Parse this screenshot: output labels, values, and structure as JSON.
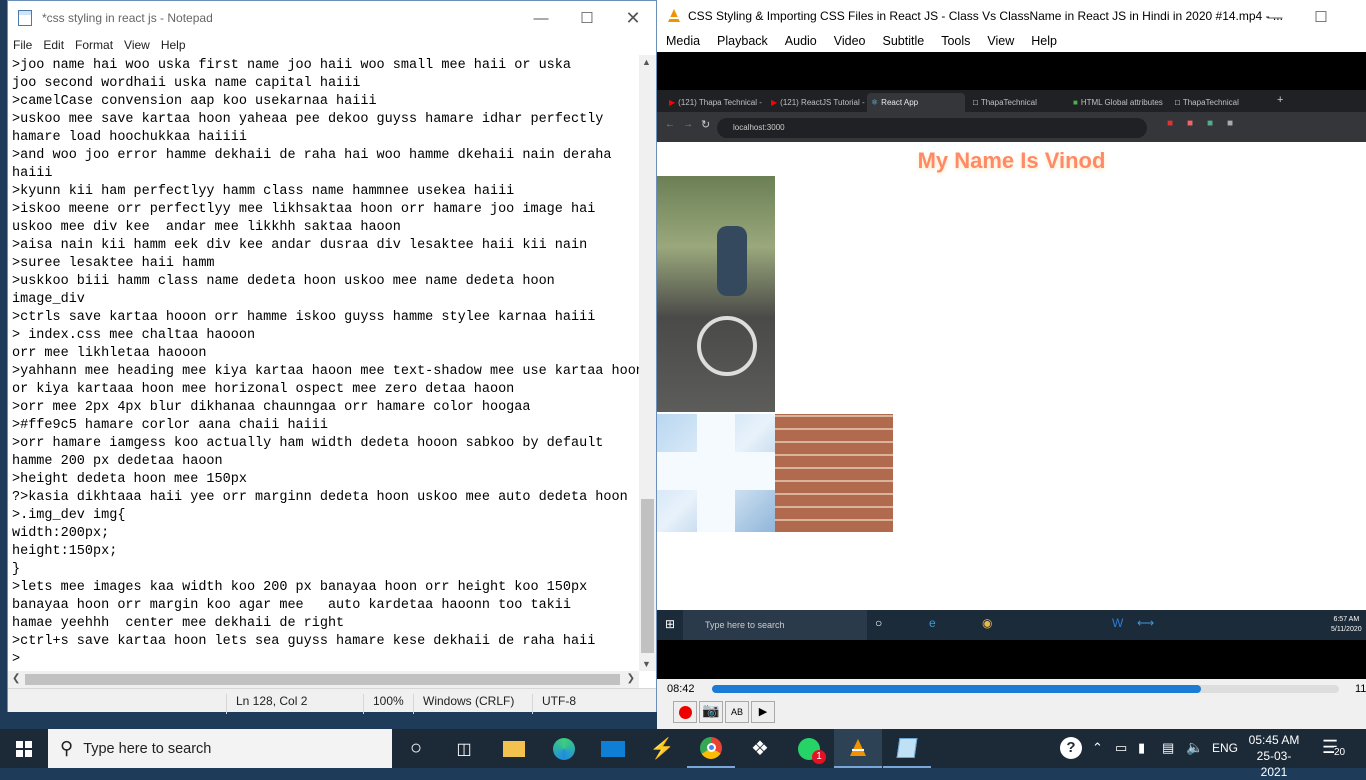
{
  "notepad": {
    "title": "*css styling in react js - Notepad",
    "menu": [
      "File",
      "Edit",
      "Format",
      "View",
      "Help"
    ],
    "lines": [
      ">joo name hai woo uska first name joo haii woo small mee haii or uska",
      "joo second wordhaii uska name capital haiii",
      ">camelCase convension aap koo usekarnaa haiii",
      ">uskoo mee save kartaa hoon yaheaa pee dekoo guyss hamare idhar perfectly",
      "hamare load hoochukkaa haiiii",
      ">and woo joo error hamme dekhaii de raha hai woo hamme dkehaii nain deraha",
      "haiii",
      ">kyunn kii ham perfectlyy hamm class name hammnee usekea haiii",
      ">iskoo meene orr perfectlyy mee likhsaktaa hoon orr hamare joo image hai",
      "uskoo mee div kee  andar mee likkhh saktaa haoon",
      ">aisa nain kii hamm eek div kee andar dusraa div lesaktee haii kii nain",
      ">suree lesaktee haii hamm",
      ">uskkoo biii hamm class name dedeta hoon uskoo mee name dedeta hoon",
      "image_div",
      ">ctrls save kartaa hooon orr hamme iskoo guyss hamme stylee karnaa haiii",
      "> index.css mee chaltaa haooon",
      "orr mee likhletaa haooon",
      ">yahhann mee heading mee kiya kartaa haoon mee text-shadow mee use kartaa hoon",
      "or kiya kartaaa hoon mee horizonal ospect mee zero detaa haoon",
      ">orr mee 2px 4px blur dikhanaa chaunngaa orr hamare color hoogaa",
      ">#ffe9c5 hamare corlor aana chaii haiii",
      ">orr hamare iamgess koo actually ham width dedeta hooon sabkoo by default",
      "hamme 200 px dedetaa haoon",
      ">height dedeta hoon mee 150px",
      "?>kasia dikhtaaa haii yee orr marginn dedeta hoon uskoo mee auto dedeta hoon",
      ">.img_dev img{",
      "width:200px;",
      "height:150px;",
      "}",
      ">lets mee images kaa width koo 200 px banayaa hoon orr height koo 150px",
      "banayaa hoon orr margin koo agar mee   auto kardetaa haoonn too takii",
      "hamae yeehhh  center mee dekhaii de right",
      ">ctrl+s save kartaa hoon lets sea guyss hamare kese dekhaii de raha haii",
      ">"
    ],
    "status": {
      "position": "Ln 128, Col 2",
      "zoom": "100%",
      "eol": "Windows (CRLF)",
      "encoding": "UTF-8"
    }
  },
  "vlc": {
    "title": "CSS Styling & Importing CSS Files in React JS - Class Vs ClassName in React JS in Hindi in 2020 #14.mp4 - ...",
    "menu": [
      "Media",
      "Playback",
      "Audio",
      "Video",
      "Subtitle",
      "Tools",
      "View",
      "Help"
    ],
    "time_elapsed": "08:42",
    "time_total": "11",
    "progress": 0.78
  },
  "video": {
    "tabs": [
      "(121) Thapa Technical -",
      "(121) ReactJS Tutorial -",
      "React App",
      "ThapaTechnical",
      "HTML Global attributes",
      "ThapaTechnical"
    ],
    "url": "localhost:3000",
    "heading": "My Name Is Vinod",
    "taskbar_search": "Type here to search",
    "clock_time": "6:57 AM",
    "clock_date": "5/11/2020"
  },
  "taskbar": {
    "search_placeholder": "Type here to search",
    "lang": "ENG",
    "time": "05:45 AM",
    "date": "25-03-2021",
    "notifications": "20",
    "whatsapp_badge": "1"
  }
}
